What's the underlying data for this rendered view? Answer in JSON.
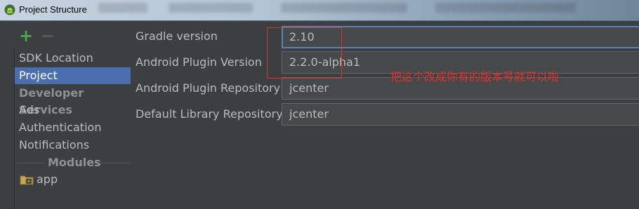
{
  "window": {
    "title": "Project Structure",
    "icon": "android-icon"
  },
  "toolbar": {
    "add_label": "+",
    "remove_label": "−"
  },
  "sidebar": {
    "sdk_location": "SDK Location",
    "project": "Project",
    "developer_services": "Developer Services",
    "ads": "Ads",
    "authentication": "Authentication",
    "notifications": "Notifications",
    "modules_header": "Modules",
    "app": "app",
    "selected": "Project"
  },
  "form": {
    "gradle_version": {
      "label": "Gradle version",
      "value": "2.10"
    },
    "android_plugin_version": {
      "label": "Android Plugin Version",
      "value": "2.2.0-alpha1"
    },
    "android_plugin_repository": {
      "label": "Android Plugin Repository",
      "value": "jcenter"
    },
    "default_library_repository": {
      "label": "Default Library Repository",
      "value": "jcenter"
    }
  },
  "annotation": {
    "text": "把这个改成你有的版本号就可以啦",
    "color": "#e03030"
  },
  "colors": {
    "background": "#3c3f41",
    "selection": "#4b6eaf",
    "focus_border": "#5a83b4",
    "add_button": "#4aa84e"
  }
}
